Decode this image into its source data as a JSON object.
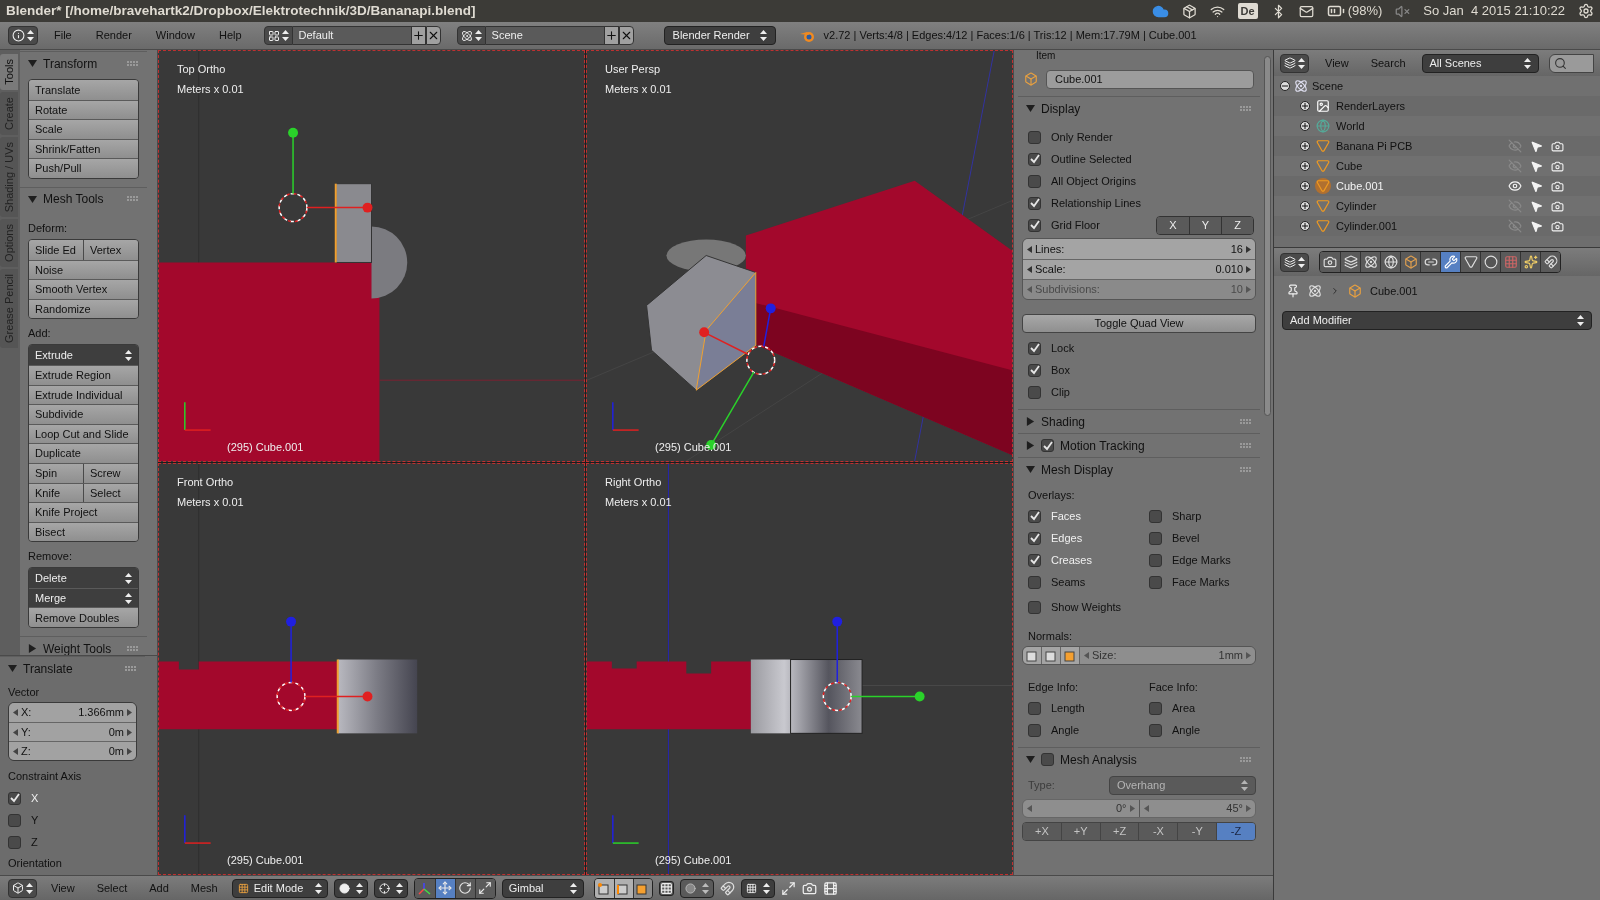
{
  "title_bar": {
    "title": "Blender* [/home/bravehartk2/Dropbox/Elektrotechnik/3D/Bananapi.blend]",
    "keyboard": "De",
    "battery": "(98%)",
    "clock": "So Jan  4 2015 21:10:22"
  },
  "info_header": {
    "menus": [
      "File",
      "Render",
      "Window",
      "Help"
    ],
    "layout": "Default",
    "scene": "Scene",
    "engine": "Blender Render",
    "stats": "v2.72 | Verts:4/8 | Edges:4/12 | Faces:1/6 | Tris:12 | Mem:17.79M | Cube.001"
  },
  "tool_tabs": [
    {
      "label": "Tools",
      "selected": true
    },
    {
      "label": "Create",
      "selected": false
    },
    {
      "label": "Shading / UVs",
      "selected": false
    },
    {
      "label": "Options",
      "selected": false
    },
    {
      "label": "Grease Pencil",
      "selected": false
    }
  ],
  "tool_panels": [
    {
      "title": "Transform",
      "expanded": true,
      "items": [
        {
          "kind": "stack",
          "rows": [
            {
              "labels": [
                "Translate"
              ],
              "dropdown": false
            },
            {
              "labels": [
                "Rotate"
              ],
              "dropdown": false
            },
            {
              "labels": [
                "Scale"
              ],
              "dropdown": false
            },
            {
              "labels": [
                "Shrink/Fatten"
              ],
              "dropdown": false
            },
            {
              "labels": [
                "Push/Pull"
              ],
              "dropdown": false
            }
          ]
        }
      ]
    },
    {
      "title": "Mesh Tools",
      "expanded": true,
      "items": [
        {
          "kind": "label",
          "text": "Deform:"
        },
        {
          "kind": "stack",
          "rows": [
            {
              "labels": [
                "Slide Ed",
                "Vertex"
              ],
              "dropdown": false
            },
            {
              "labels": [
                "Noise"
              ],
              "dropdown": false
            },
            {
              "labels": [
                "Smooth Vertex"
              ],
              "dropdown": false
            },
            {
              "labels": [
                "Randomize"
              ],
              "dropdown": false
            }
          ]
        },
        {
          "kind": "label",
          "text": "Add:"
        },
        {
          "kind": "stack",
          "rows": [
            {
              "labels": [
                "Extrude"
              ],
              "dropdown": true
            },
            {
              "labels": [
                "Extrude Region"
              ],
              "dropdown": false
            },
            {
              "labels": [
                "Extrude Individual"
              ],
              "dropdown": false
            },
            {
              "labels": [
                "Subdivide"
              ],
              "dropdown": false
            },
            {
              "labels": [
                "Loop Cut and Slide"
              ],
              "dropdown": false
            },
            {
              "labels": [
                "Duplicate"
              ],
              "dropdown": false
            },
            {
              "labels": [
                "Spin",
                "Screw"
              ],
              "dropdown": false
            },
            {
              "labels": [
                "Knife",
                "Select"
              ],
              "dropdown": false
            },
            {
              "labels": [
                "Knife Project"
              ],
              "dropdown": false
            },
            {
              "labels": [
                "Bisect"
              ],
              "dropdown": false
            }
          ]
        },
        {
          "kind": "label",
          "text": "Remove:"
        },
        {
          "kind": "stack",
          "rows": [
            {
              "labels": [
                "Delete"
              ],
              "dropdown": true
            },
            {
              "labels": [
                "Merge"
              ],
              "dropdown": true
            },
            {
              "labels": [
                "Remove Doubles"
              ],
              "dropdown": false
            }
          ]
        }
      ]
    },
    {
      "title": "Weight Tools",
      "expanded": false
    }
  ],
  "operator_panel": {
    "title": "Translate",
    "expanded": true,
    "vector_label": "Vector",
    "vector": [
      {
        "label": "X:",
        "value": "1.366mm"
      },
      {
        "label": "Y:",
        "value": "0m"
      },
      {
        "label": "Z:",
        "value": "0m"
      }
    ],
    "constraint_label": "Constraint Axis",
    "constraint": [
      {
        "label": "X",
        "checked": true
      },
      {
        "label": "Y",
        "checked": false
      },
      {
        "label": "Z",
        "checked": false
      }
    ],
    "orientation_label": "Orientation"
  },
  "viewports": [
    {
      "kind": "top",
      "name": "Top Ortho",
      "units": "Meters x 0.01",
      "object": "(295) Cube.001"
    },
    {
      "kind": "persp",
      "name": "User Persp",
      "units": "Meters x 0.01",
      "object": "(295) Cube.001"
    },
    {
      "kind": "front",
      "name": "Front Ortho",
      "units": "Meters x 0.01",
      "object": "(295) Cube.001"
    },
    {
      "kind": "right",
      "name": "Right Ortho",
      "units": "Meters x 0.01",
      "object": "(295) Cube.001"
    }
  ],
  "n_panel": {
    "item_title": "Item",
    "object_name": "Cube.001",
    "display": {
      "title": "Display",
      "expanded": true,
      "options": [
        {
          "label": "Only Render",
          "checked": false
        },
        {
          "label": "Outline Selected",
          "checked": true
        },
        {
          "label": "All Object Origins",
          "checked": false
        },
        {
          "label": "Relationship Lines",
          "checked": true
        }
      ],
      "grid_floor": {
        "label": "Grid Floor",
        "checked": true,
        "axes": [
          {
            "label": "X",
            "selected": false
          },
          {
            "label": "Y",
            "selected": false
          },
          {
            "label": "Z",
            "selected": false
          }
        ]
      },
      "fields": [
        {
          "label": "Lines:",
          "value": "16",
          "disabled": false
        },
        {
          "label": "Scale:",
          "value": "0.010",
          "disabled": false
        },
        {
          "label": "Subdivisions:",
          "value": "10",
          "disabled": true
        }
      ],
      "quad_button": "Toggle Quad View",
      "quad_options": [
        {
          "label": "Lock",
          "checked": true
        },
        {
          "label": "Box",
          "checked": true
        },
        {
          "label": "Clip",
          "checked": false
        }
      ]
    },
    "shading": {
      "title": "Shading",
      "expanded": false
    },
    "motion_tracking": {
      "title": "Motion Tracking",
      "expanded": false,
      "checked": true
    },
    "mesh_display": {
      "title": "Mesh Display",
      "expanded": true,
      "overlays_label": "Overlays:",
      "overlays": [
        {
          "label": "Faces",
          "checked": true
        },
        {
          "label": "Sharp",
          "checked": false
        },
        {
          "label": "Edges",
          "checked": true
        },
        {
          "label": "Bevel",
          "checked": false
        },
        {
          "label": "Creases",
          "checked": true
        },
        {
          "label": "Edge Marks",
          "checked": false
        },
        {
          "label": "Seams",
          "checked": false
        },
        {
          "label": "Face Marks",
          "checked": false
        }
      ],
      "show_weights": {
        "label": "Show Weights",
        "checked": false
      },
      "normals_label": "Normals:",
      "normal_size_label": "Size:",
      "normal_size": "1mm",
      "edge_info_label": "Edge Info:",
      "face_info_label": "Face Info:",
      "info": [
        {
          "label": "Length",
          "checked": false
        },
        {
          "label": "Area",
          "checked": false
        },
        {
          "label": "Angle",
          "checked": false
        },
        {
          "label": "Angle",
          "checked": false
        }
      ]
    },
    "mesh_analysis": {
      "title": "Mesh Analysis",
      "expanded": true,
      "checked": false,
      "type_label": "Type:",
      "type": "Overhang",
      "range": [
        "0°",
        "45°"
      ],
      "axes": [
        {
          "label": "+X",
          "selected": false
        },
        {
          "label": "+Y",
          "selected": false
        },
        {
          "label": "+Z",
          "selected": false
        },
        {
          "label": "-X",
          "selected": false
        },
        {
          "label": "-Y",
          "selected": false
        },
        {
          "label": "-Z",
          "selected": true
        }
      ]
    }
  },
  "outliner": {
    "menus": [
      "View",
      "Search"
    ],
    "filter": "All Scenes",
    "tree": [
      {
        "name": "Scene",
        "kind": "scene",
        "expanded": true,
        "children": [
          {
            "name": "RenderLayers",
            "kind": "renderlayers",
            "expanded": false
          },
          {
            "name": "World",
            "kind": "world",
            "expanded": false
          },
          {
            "name": "Banana Pi PCB",
            "kind": "mesh",
            "expanded": false,
            "selected": false,
            "visible": false
          },
          {
            "name": "Cube",
            "kind": "mesh",
            "expanded": false,
            "selected": false,
            "visible": false
          },
          {
            "name": "Cube.001",
            "kind": "mesh",
            "expanded": false,
            "selected": true,
            "visible": true
          },
          {
            "name": "Cylinder",
            "kind": "mesh",
            "expanded": false,
            "selected": false,
            "visible": false
          },
          {
            "name": "Cylinder.001",
            "kind": "mesh",
            "expanded": false,
            "selected": false,
            "visible": false
          }
        ]
      }
    ]
  },
  "properties_editor": {
    "tabs": [
      {
        "kind": "render",
        "selected": false
      },
      {
        "kind": "layers",
        "selected": false
      },
      {
        "kind": "scene",
        "selected": false
      },
      {
        "kind": "world",
        "selected": false
      },
      {
        "kind": "object",
        "selected": false
      },
      {
        "kind": "constraints",
        "selected": false
      },
      {
        "kind": "modifiers",
        "selected": true
      },
      {
        "kind": "data",
        "selected": false
      },
      {
        "kind": "material",
        "selected": false
      },
      {
        "kind": "texture",
        "selected": false
      },
      {
        "kind": "particles",
        "selected": false
      },
      {
        "kind": "physics",
        "selected": false
      }
    ],
    "breadcrumb": "Cube.001",
    "add_modifier": "Add Modifier"
  },
  "bottom_header": {
    "menus": [
      "View",
      "Select",
      "Add",
      "Mesh"
    ],
    "mode": "Edit Mode",
    "manipulators": [
      {
        "kind": "translate",
        "selected": true
      },
      {
        "kind": "rotate",
        "selected": false
      },
      {
        "kind": "scale",
        "selected": false
      }
    ],
    "orientation": "Gimbal",
    "select_modes": [
      {
        "kind": "vertex",
        "selected": false
      },
      {
        "kind": "edge",
        "selected": false
      },
      {
        "kind": "face",
        "selected": true
      }
    ]
  }
}
